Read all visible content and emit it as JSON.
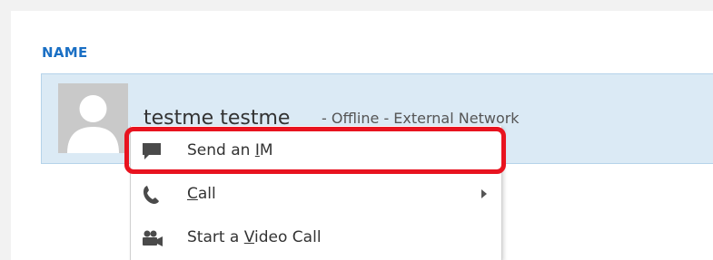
{
  "section": {
    "header": "NAME"
  },
  "contact": {
    "name": "testme testme",
    "status": "- Offline - External Network"
  },
  "context_menu": {
    "items": [
      {
        "label_pre": "Send an ",
        "mnemonic": "I",
        "label_post": "M",
        "icon": "chat-bubble-icon",
        "has_submenu": false
      },
      {
        "label_pre": "",
        "mnemonic": "C",
        "label_post": "all",
        "icon": "phone-icon",
        "has_submenu": true
      },
      {
        "label_pre": "Start a ",
        "mnemonic": "V",
        "label_post": "ideo Call",
        "icon": "video-camera-icon",
        "has_submenu": false
      }
    ]
  },
  "colors": {
    "header": "#1a6fc4",
    "row_selected": "#dbeaf5",
    "annotation": "#e8131f"
  },
  "annotation": {
    "highlighted_item": "Send an IM"
  }
}
